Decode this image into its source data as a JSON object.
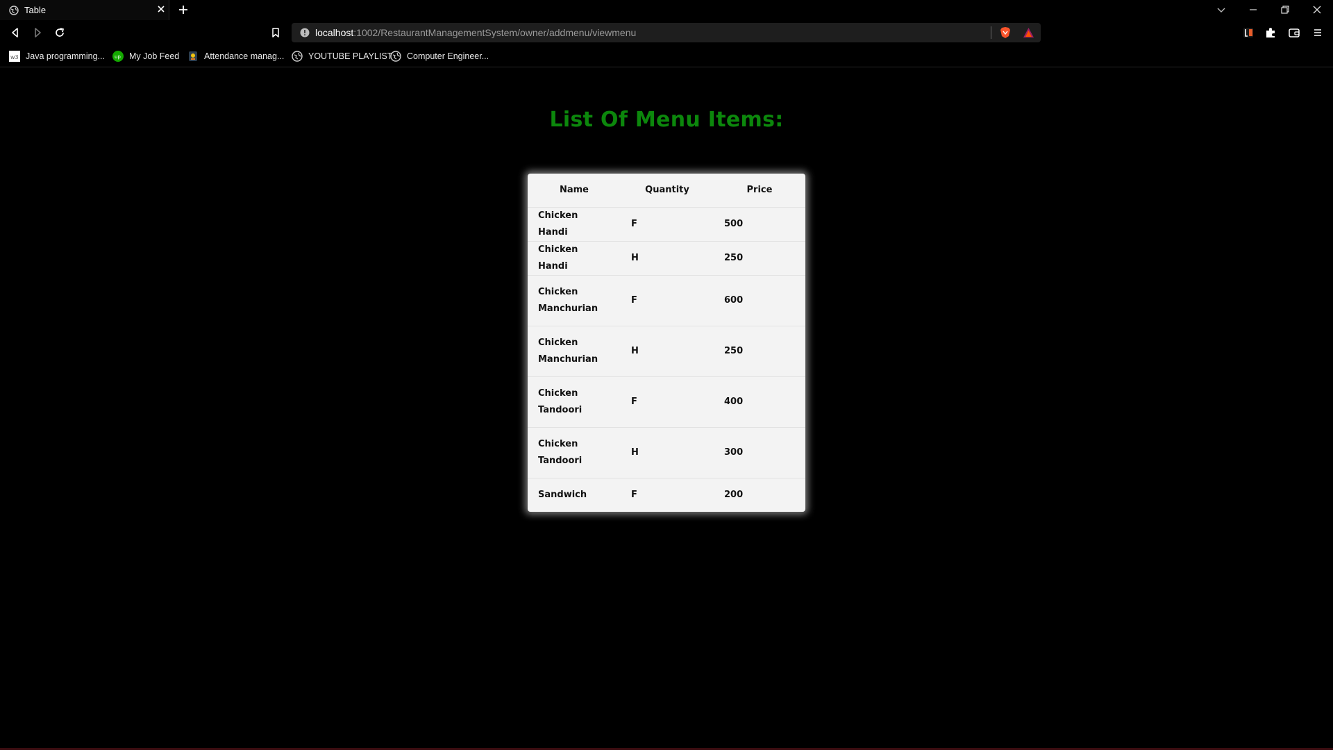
{
  "browser": {
    "tab": {
      "title": "Table"
    },
    "address_bar": {
      "host": "localhost",
      "path": ":1002/RestaurantManagementSystem/owner/addmenu/viewmenu"
    },
    "bookmarks": [
      {
        "label": "Java programming...",
        "icon": "w3-icon"
      },
      {
        "label": "My Job Feed",
        "icon": "upwork-icon"
      },
      {
        "label": "Attendance manag...",
        "icon": "app-icon"
      },
      {
        "label": "YOUTUBE PLAYLIST",
        "icon": "globe-icon"
      },
      {
        "label": "Computer Engineer...",
        "icon": "globe-icon"
      }
    ],
    "colors": {
      "background": "#000000",
      "address_bar": "#1e1e1e",
      "brave_orange": "#fb542b"
    }
  },
  "page": {
    "title": "List Of Menu Items:",
    "title_color": "#0c870c",
    "table": {
      "headers": {
        "name": "Name",
        "quantity": "Quantity",
        "price": "Price"
      },
      "rows": [
        {
          "name": "Chicken Handi",
          "quantity": "F",
          "price": "500"
        },
        {
          "name": "Chicken Handi",
          "quantity": "H",
          "price": "250"
        },
        {
          "name": "Chicken Manchurian",
          "quantity": "F",
          "price": "600"
        },
        {
          "name": "Chicken Manchurian",
          "quantity": "H",
          "price": "250"
        },
        {
          "name": "Chicken Tandoori",
          "quantity": "F",
          "price": "400"
        },
        {
          "name": "Chicken Tandoori",
          "quantity": "H",
          "price": "300"
        },
        {
          "name": "Sandwich",
          "quantity": "F",
          "price": "200"
        }
      ]
    }
  }
}
